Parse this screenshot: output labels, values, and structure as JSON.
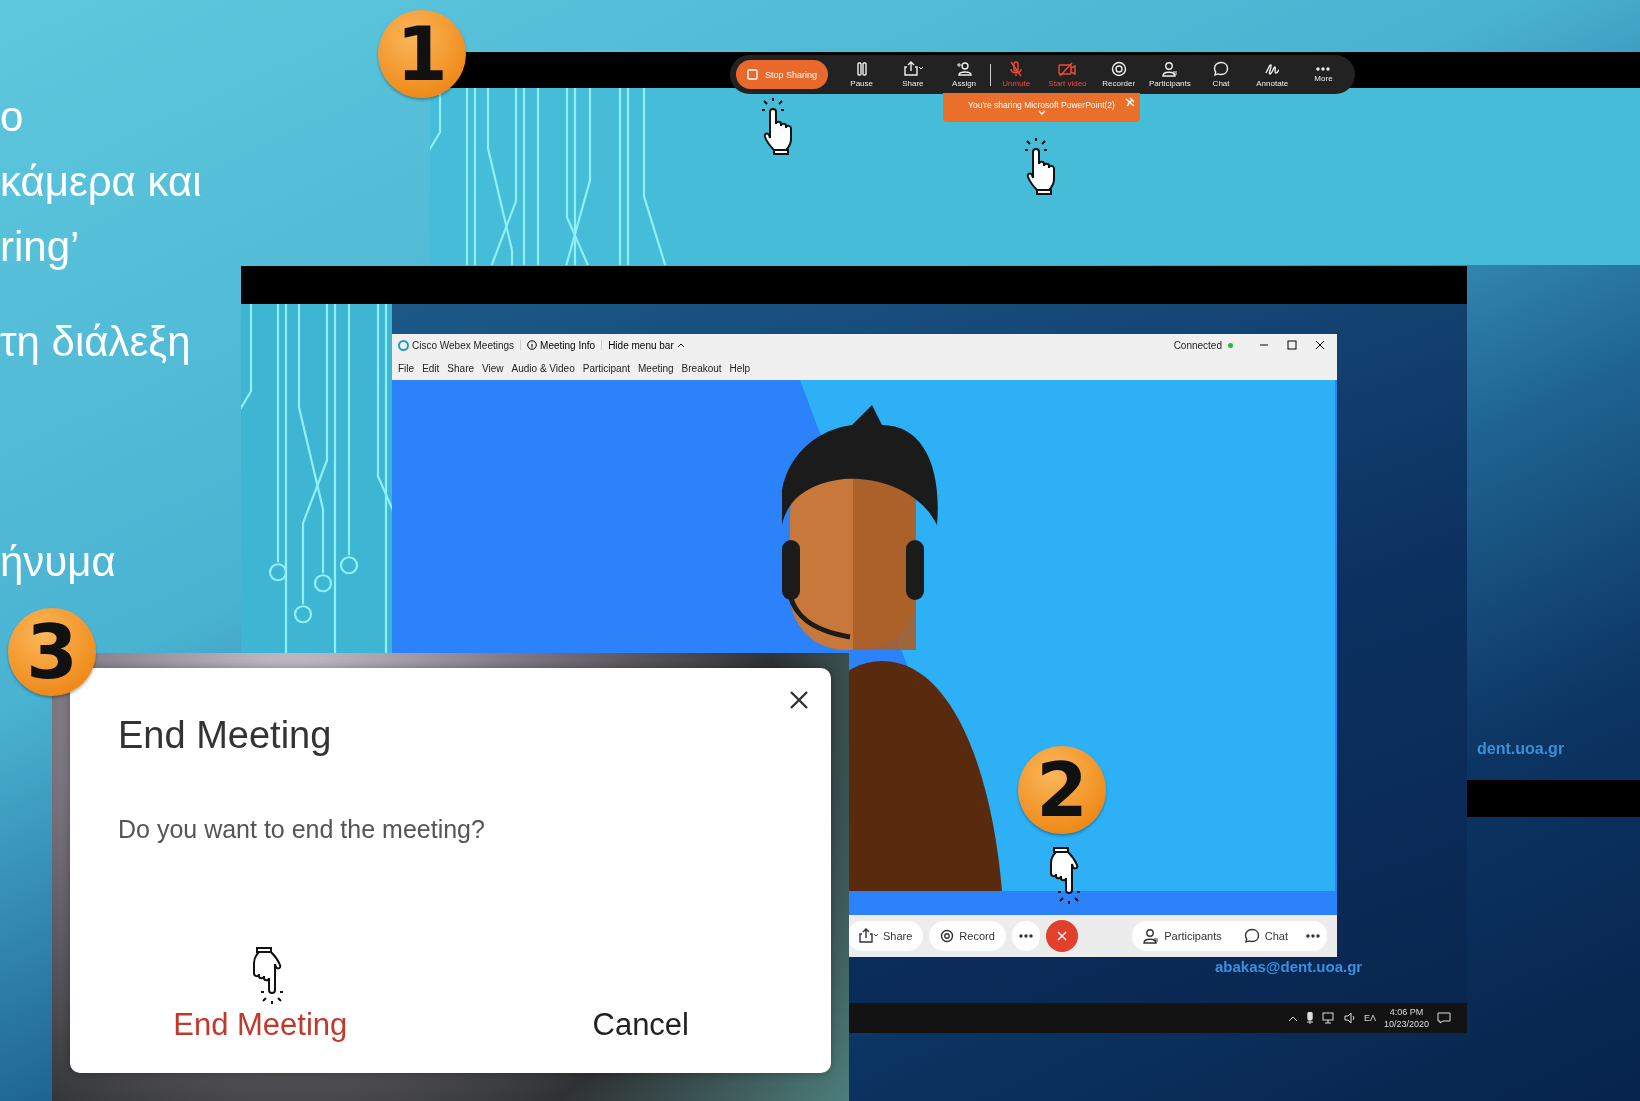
{
  "slide_text": {
    "paragraphs": [
      [
        "ο",
        "κάμερα και",
        "ring’"
      ],
      [
        "τη διάλεξη"
      ],
      [
        "ήνυμα"
      ]
    ]
  },
  "step_badges": [
    "1",
    "2",
    "3"
  ],
  "sharing_toolbar": {
    "stop_label": "Stop Sharing",
    "items": [
      {
        "kind": "pause",
        "label": "Pause",
        "alert": false
      },
      {
        "kind": "share",
        "label": "Share",
        "alert": false
      },
      {
        "kind": "assign",
        "label": "Assign",
        "alert": false
      },
      {
        "kind": "unmute",
        "label": "Unmute",
        "alert": true
      },
      {
        "kind": "video",
        "label": "Start video",
        "alert": true
      },
      {
        "kind": "recorder",
        "label": "Recorder",
        "alert": false
      },
      {
        "kind": "participants",
        "label": "Participants",
        "alert": false
      },
      {
        "kind": "chat",
        "label": "Chat",
        "alert": false
      },
      {
        "kind": "annotate",
        "label": "Annotate",
        "alert": false
      },
      {
        "kind": "more",
        "label": "More",
        "alert": false
      }
    ]
  },
  "sharing_banner": {
    "text": "You're sharing Microsoft PowerPoint(2)"
  },
  "webex_window": {
    "title": "Cisco Webex Meetings",
    "meeting_info": "Meeting Info",
    "hide_menu": "Hide menu bar",
    "status": "Connected",
    "menu": [
      "File",
      "Edit",
      "Share",
      "View",
      "Audio & Video",
      "Participant",
      "Meeting",
      "Breakout",
      "Help"
    ],
    "left_controls": [
      {
        "kind": "share",
        "label": "Share"
      },
      {
        "kind": "record",
        "label": "Record"
      },
      {
        "kind": "more"
      },
      {
        "kind": "end"
      }
    ],
    "right_controls": [
      {
        "kind": "participants",
        "label": "Participants"
      },
      {
        "kind": "chat",
        "label": "Chat"
      },
      {
        "kind": "more"
      }
    ]
  },
  "slide_footer": "dent.uoa.gr",
  "screen_footer": "abakas@dent.uoa.gr",
  "taskbar": {
    "language": "ΕΛ",
    "time": "4:06 PM",
    "date": "10/23/2020"
  },
  "end_dialog": {
    "title": "End Meeting",
    "message": "Do you want to end the meeting?",
    "confirm": "End Meeting",
    "cancel": "Cancel"
  }
}
